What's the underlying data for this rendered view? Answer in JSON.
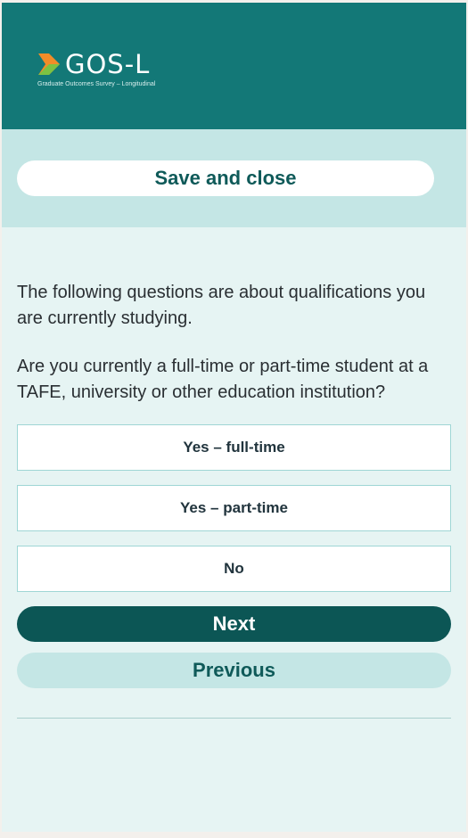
{
  "header": {
    "logo_text": "GOS-L",
    "logo_subtitle": "Graduate Outcomes Survey – Longitudinal",
    "logo_icon": "chevron-arrow-icon",
    "colors": {
      "header_bg": "#137877",
      "arrow_orange": "#f28c28",
      "arrow_green": "#7cc242"
    }
  },
  "save": {
    "label": "Save and close"
  },
  "survey": {
    "intro": "The following questions are about qualifications you are currently studying.",
    "question": "Are you currently a full-time or part-time student at a TAFE, university or other education institution?",
    "options": [
      {
        "label": "Yes – full-time"
      },
      {
        "label": "Yes – part-time"
      },
      {
        "label": "No"
      }
    ]
  },
  "navigation": {
    "next_label": "Next",
    "previous_label": "Previous"
  },
  "colors": {
    "page_bg": "#e6f4f3",
    "band_bg": "#c4e6e5",
    "primary": "#0c5655",
    "option_border": "#9fd6d5"
  }
}
